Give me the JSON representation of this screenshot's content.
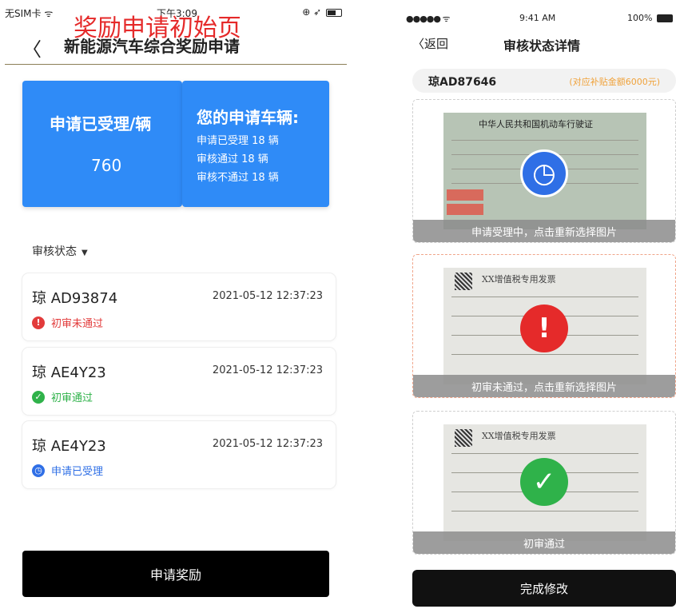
{
  "left": {
    "status_bar": {
      "carrier": "无SIM卡 ᯤ",
      "time": "下午3:09",
      "icons": "⊕ ➶"
    },
    "overlay_title": "奖励申请初始页",
    "back_icon": "chevron-left-icon",
    "nav_title": "新能源汽车综合奖励申请",
    "summary_card": {
      "title": "申请已受理/辆",
      "count": "760"
    },
    "vehicles_card": {
      "title": "您的申请车辆:",
      "lines": [
        "申请已受理 18 辆",
        "审核通过 18 辆",
        "审核不通过 18 辆"
      ]
    },
    "filter": {
      "label": "审核状态",
      "caret": "▼"
    },
    "records": [
      {
        "plate": "琼 AD93874",
        "datetime": "2021-05-12  12:37:23",
        "status": "初审未通过",
        "status_type": "rejected",
        "status_color": "#e23b3b"
      },
      {
        "plate": "琼 AE4Y23",
        "datetime": "2021-05-12  12:37:23",
        "status": "初审通过",
        "status_type": "approved",
        "status_color": "#2fb24a"
      },
      {
        "plate": "琼 AE4Y23",
        "datetime": "2021-05-12  12:37:23",
        "status": "申请已受理",
        "status_type": "accepted",
        "status_color": "#2f6fe6"
      }
    ],
    "apply_button": "申请奖励"
  },
  "right": {
    "status_bar": {
      "signal": "●●●●● ᯤ",
      "time": "9:41 AM",
      "battery": "100%"
    },
    "back_label": "〈返回",
    "nav_title": "审核状态详情",
    "plate": "琼AD87646",
    "subsidy": "(对应补贴金额6000元)",
    "images": [
      {
        "caption": "申请受理中，点击重新选择图片",
        "doc_title": "中华人民共和国机动车行驶证",
        "badge": "clock-icon"
      },
      {
        "caption": "初审未通过，点击重新选择图片",
        "doc_title": "XX增值税专用发票",
        "badge": "exclamation-icon"
      },
      {
        "caption": "初审通过",
        "doc_title": "XX增值税专用发票",
        "badge": "check-icon"
      }
    ],
    "done_button": "完成修改"
  },
  "colors": {
    "primary_blue": "#2f8bf7",
    "overlay_red": "#e52a2a",
    "subsidy_orange": "#f0a23a"
  }
}
